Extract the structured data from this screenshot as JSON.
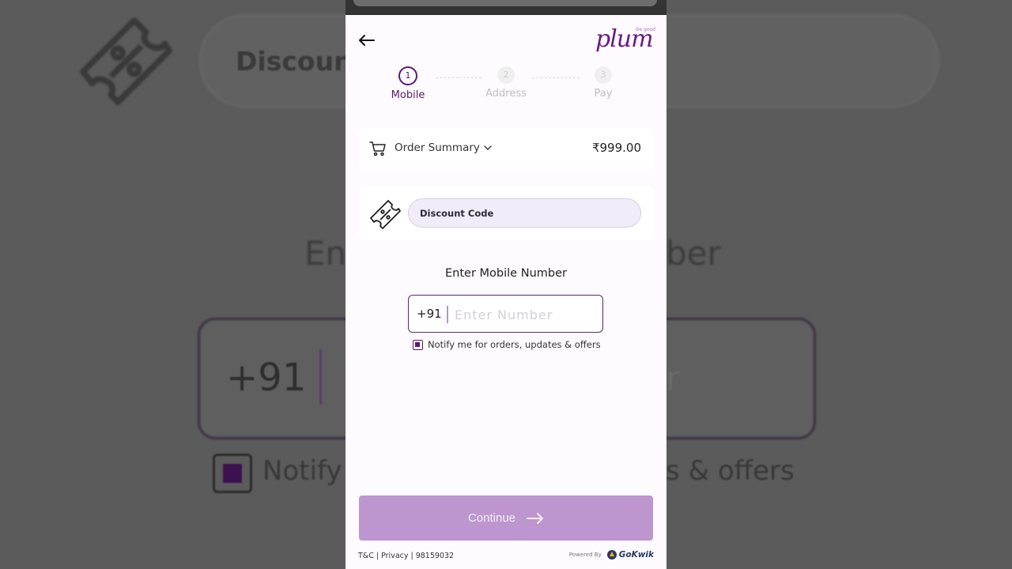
{
  "background": {
    "discount_label": "Discoun",
    "title_left": "En",
    "title_right": "ber",
    "country_code": "+91",
    "placeholder_tail": "r",
    "notify_left": "Notify",
    "notify_right": "s & offers"
  },
  "brand": {
    "logo": "plum",
    "tagline": "be good"
  },
  "steps": [
    {
      "number": "1",
      "label": "Mobile",
      "state": "active"
    },
    {
      "number": "2",
      "label": "Address",
      "state": "inactive"
    },
    {
      "number": "3",
      "label": "Pay",
      "state": "inactive"
    }
  ],
  "order_summary": {
    "label": "Order Summary",
    "price": "₹999.00",
    "icon": "cart-icon"
  },
  "discount": {
    "placeholder": "Discount Code",
    "icon": "ticket-icon"
  },
  "mobile": {
    "title": "Enter Mobile Number",
    "country_code": "+91",
    "placeholder": "Enter Number"
  },
  "notify": {
    "label": "Notify me for orders, updates & offers",
    "checked": true
  },
  "continue_button": {
    "label": "Continue",
    "icon": "arrow-right-icon"
  },
  "footer": {
    "links": "T&C | Privacy | 98159032",
    "powered_by": "Powered By",
    "provider": "GoKwik"
  },
  "colors": {
    "accent": "#5a1a73",
    "button": "#bd96cf",
    "brand": "#6b1a86"
  }
}
